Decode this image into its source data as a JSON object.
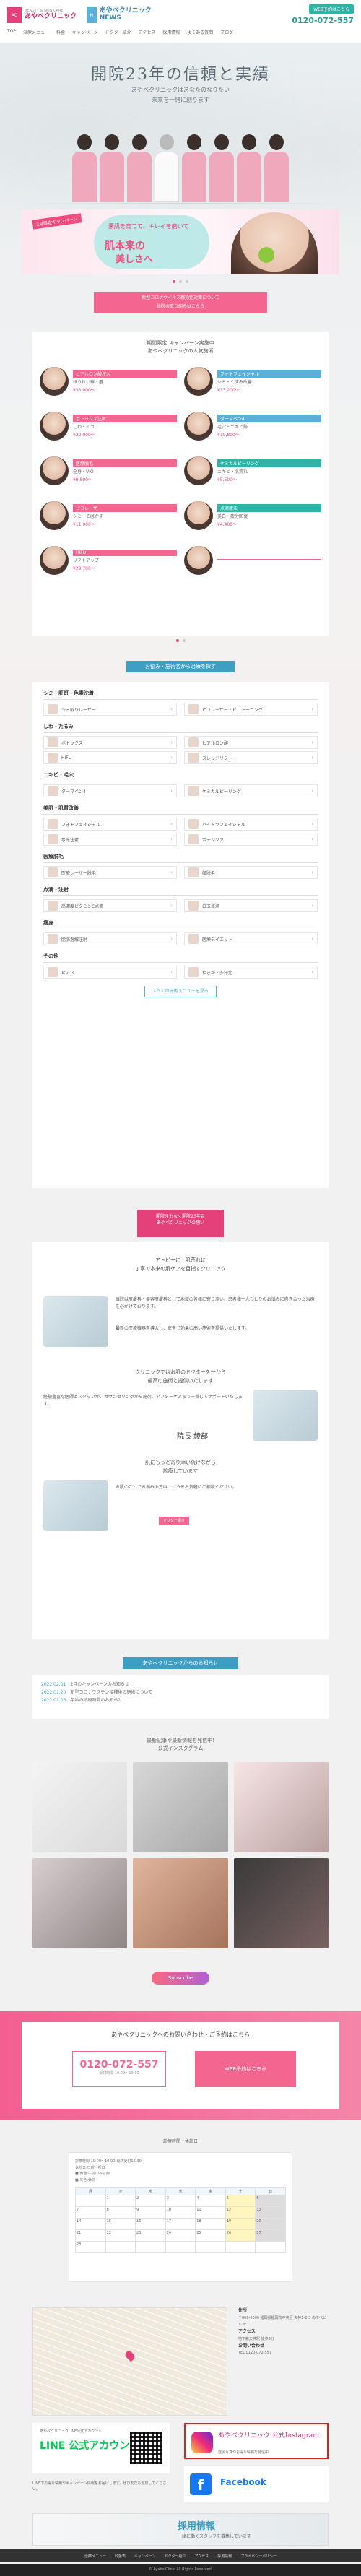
{
  "header": {
    "logo_clinic": "あやべクリニック",
    "logo_clinic_sub": "BEAUTY & SKIN CARE",
    "logo_news": "あやべクリニック NEWS",
    "reserve_label": "WEB予約はこちら",
    "tel": "0120-072-557",
    "nav": [
      "TOP",
      "治療メニュー",
      "料金",
      "キャンペーン",
      "ドクター紹介",
      "アクセス",
      "採用情報",
      "よくある質問",
      "ブログ"
    ]
  },
  "hero": {
    "title": "開院23年の信頼と実績",
    "subtitle_1": "あやべクリニックはあなたのなりたい",
    "subtitle_2": "未来を一緒に創ります"
  },
  "banner": {
    "tag": "2月限定キャンペーン",
    "line1": "素肌を育てて、キレイを磨いて",
    "line2": "肌本来の",
    "line3": "美しさへ"
  },
  "notice": {
    "line1": "新型コロナウイルス感染症対策について",
    "line2": "当院の取り組みはこちら"
  },
  "campaign": {
    "heading_1": "期間限定!キャンペーン実施中",
    "heading_2": "あやべクリニックの人気施術",
    "items": [
      {
        "title": "ヒアルロン酸注入",
        "desc": "ほうれい線・唇",
        "price": "¥33,000〜",
        "c": "p"
      },
      {
        "title": "フォトフェイシャル",
        "desc": "シミ・くすみ改善",
        "price": "¥13,200〜",
        "c": "b"
      },
      {
        "title": "ボトックス注射",
        "desc": "しわ・エラ",
        "price": "¥22,000〜",
        "c": "p"
      },
      {
        "title": "ダーマペン4",
        "desc": "毛穴・ニキビ跡",
        "price": "¥19,800〜",
        "c": "b"
      },
      {
        "title": "医療脱毛",
        "desc": "全身・VIO",
        "price": "¥9,800〜",
        "c": "p"
      },
      {
        "title": "ケミカルピーリング",
        "desc": "ニキビ・肌荒れ",
        "price": "¥5,500〜",
        "c": "g"
      },
      {
        "title": "ピコレーザー",
        "desc": "シミ・そばかす",
        "price": "¥11,000〜",
        "c": "p"
      },
      {
        "title": "点滴療法",
        "desc": "美白・疲労回復",
        "price": "¥4,400〜",
        "c": "g"
      },
      {
        "title": "HIFU",
        "desc": "リフトアップ",
        "price": "¥29,700〜",
        "c": "p"
      },
      {
        "title": "",
        "desc": "",
        "price": "",
        "c": "p"
      }
    ]
  },
  "treatments": {
    "title": "お悩み・施術名から治療を探す",
    "more_label": "すべての施術メニューを見る",
    "cats": [
      {
        "name": "シミ・肝斑・色素沈着",
        "items": [
          "シミ取りレーザー",
          "ピコレーザー・ピコトーニング"
        ]
      },
      {
        "name": "しわ・たるみ",
        "items": [
          "ボトックス",
          "ヒアルロン酸",
          "HIFU",
          "スレッドリフト"
        ]
      },
      {
        "name": "ニキビ・毛穴",
        "items": [
          "ダーマペン4",
          "ケミカルピーリング"
        ]
      },
      {
        "name": "美肌・肌質改善",
        "items": [
          "フォトフェイシャル",
          "ハイドラフェイシャル",
          "水光注射",
          "ポテンツァ"
        ]
      },
      {
        "name": "医療脱毛",
        "items": [
          "医療レーザー脱毛",
          "顔脱毛"
        ]
      },
      {
        "name": "点滴・注射",
        "items": [
          "高濃度ビタミンC点滴",
          "白玉点滴"
        ]
      },
      {
        "name": "痩身",
        "items": [
          "脂肪溶解注射",
          "医療ダイエット"
        ]
      },
      {
        "name": "その他",
        "items": [
          "ピアス",
          "わきが・多汗症"
        ]
      }
    ]
  },
  "greeting": {
    "title_1": "開院まもなく開院23年目",
    "title_2": "あやべクリニックの想い",
    "lead_1": "アトピーに・肌荒れに",
    "lead_2": "丁寧で本来の肌ケアを目指すクリニック",
    "p1": "当院は皮膚科・美容皮膚科として地域の皆様に寄り添い、患者様一人ひとりのお悩みに向き合った治療を心がけております。",
    "p2": "最新の医療機器を導入し、安全で効果の高い施術を提供いたします。",
    "lead2_1": "クリニックではお肌のドクターを一から",
    "lead2_2": "最高の施術と提供いたします",
    "p3": "経験豊富な医師とスタッフが、カウンセリングから施術、アフターケアまで一貫してサポートいたします。",
    "lead3_1": "肌にもっと寄り添い続けながら",
    "lead3_2": "診療しています",
    "p4": "お肌のことでお悩みの方は、どうぞお気軽にご相談ください。",
    "sign": "院長 綾部",
    "btn": "ドクター紹介"
  },
  "news": {
    "title": "あやべクリニックからのお知らせ",
    "items": [
      {
        "date": "2022.02.01",
        "text": "2月のキャンペーンのお知らせ"
      },
      {
        "date": "2022.01.20",
        "text": "新型コロナワクチン接種後の施術について"
      },
      {
        "date": "2022.01.05",
        "text": "年始の診療時間のお知らせ"
      }
    ]
  },
  "instagram": {
    "head_1": "最新記事や最新情報を発信中!",
    "head_2": "公式インスタグラム",
    "subscribe": "Subscribe"
  },
  "contact": {
    "heading": "あやべクリニックへのお問い合わせ・ご予約はこちら",
    "tel": "0120-072-557",
    "tel_note": "受付時間 10:00〜19:00",
    "web": "WEB予約はこちら"
  },
  "calendar": {
    "title": "診療時間・休診日",
    "legend_1": "診療時間 10:00〜19:00(最終受付18:30)",
    "legend_2": "休診日:日曜・祝日",
    "legend_3": "■ 黄色:午前のみ診療",
    "legend_4": "■ 灰色:休診",
    "days": [
      "月",
      "火",
      "水",
      "木",
      "金",
      "土",
      "日"
    ],
    "rows": [
      [
        "",
        "1",
        "2",
        "3",
        "4",
        "5",
        "6"
      ],
      [
        "7",
        "8",
        "9",
        "10",
        "11",
        "12",
        "13"
      ],
      [
        "14",
        "15",
        "16",
        "17",
        "18",
        "19",
        "20"
      ],
      [
        "21",
        "22",
        "23",
        "24",
        "25",
        "26",
        "27"
      ],
      [
        "28",
        "",
        "",
        "",
        "",
        "",
        ""
      ]
    ]
  },
  "access": {
    "h1": "住所",
    "addr": "〒000-0000 福岡県福岡市中央区 天神1-2-3 あやべビル3F",
    "h2": "アクセス",
    "route": "地下鉄天神駅 徒歩3分",
    "h3": "お問い合わせ",
    "tel": "TEL 0120-072-557"
  },
  "sns": {
    "line_head": "あやべクリニックLINE公式アカウント",
    "line_logo": "LINE 公式アカウント",
    "line_text": "LINEでお得な情報やキャンペーン情報をお届けします。ぜひ友だち追加してください。",
    "ig_title": "あやべクリニック 公式Instagram",
    "ig_sub": "症例写真やお得な情報を発信中",
    "fb_label": "Facebook"
  },
  "recruit": {
    "title": "採用情報",
    "sub": "一緒に働くスタッフを募集しています"
  },
  "footer": {
    "nav": [
      "治療メニュー",
      "料金表",
      "キャンペーン",
      "ドクター紹介",
      "アクセス",
      "採用情報",
      "プライバシーポリシー"
    ],
    "copyright": "© Ayabe Clinic All Rights Reserved."
  }
}
